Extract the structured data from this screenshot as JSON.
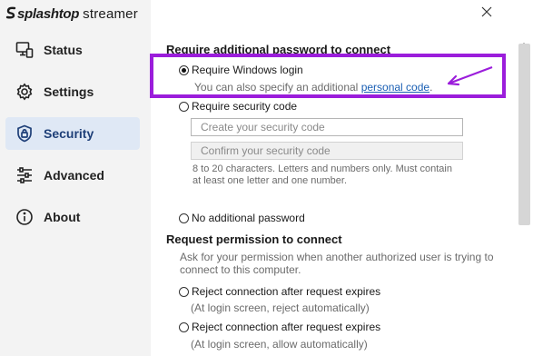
{
  "app": {
    "brand": "splashtop",
    "product": "streamer"
  },
  "sidebar": {
    "items": [
      {
        "label": "Status",
        "icon": "monitor-status-icon"
      },
      {
        "label": "Settings",
        "icon": "gear-icon"
      },
      {
        "label": "Security",
        "icon": "shield-lock-icon",
        "active": true
      },
      {
        "label": "Advanced",
        "icon": "sliders-icon"
      },
      {
        "label": "About",
        "icon": "info-icon"
      }
    ]
  },
  "security": {
    "title": "Require additional password to connect",
    "options": {
      "windows_login": {
        "label": "Require Windows login",
        "checked": true,
        "hint_prefix": "You can also specify an additional ",
        "hint_link": "personal code",
        "hint_suffix": "."
      },
      "security_code": {
        "label": "Require security code",
        "checked": false,
        "create_placeholder": "Create your security code",
        "confirm_placeholder": "Confirm your security code",
        "note_line1": "8 to 20 characters. Letters and numbers only. Must contain",
        "note_line2": "at least one letter and one number."
      },
      "no_password": {
        "label": "No additional password",
        "checked": false
      }
    }
  },
  "permission": {
    "title": "Request permission to connect",
    "desc_line1": "Ask for your permission when another authorized user is trying to",
    "desc_line2": "connect to this computer.",
    "options": [
      {
        "label": "Reject connection after request expires",
        "sub": "(At login screen, reject automatically)",
        "checked": false
      },
      {
        "label": "Reject connection after request expires",
        "sub": "(At login screen, allow automatically)",
        "checked": false
      }
    ]
  },
  "colors": {
    "accent": "#1e3f78",
    "active_bg": "#dfe8f5",
    "highlight": "#9b1ddb",
    "link": "#1a5fb4"
  }
}
